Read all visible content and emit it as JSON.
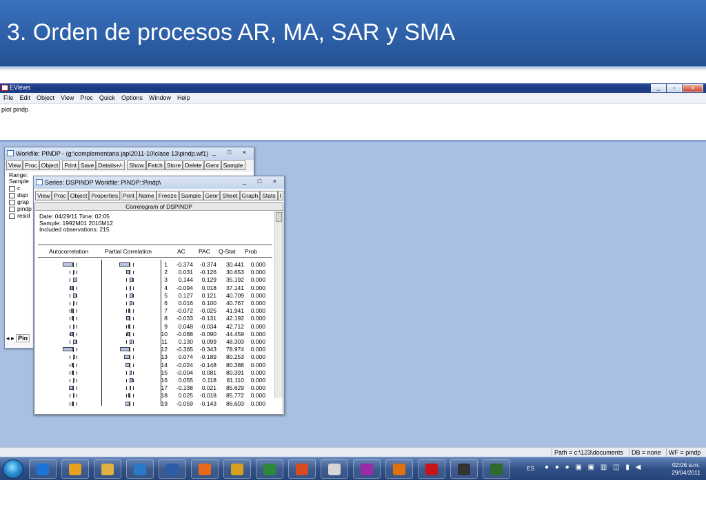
{
  "slide": {
    "title": "3. Orden de procesos AR, MA, SAR y SMA"
  },
  "eviews": {
    "title": "EViews",
    "menu": [
      "File",
      "Edit",
      "Object",
      "View",
      "Proc",
      "Quick",
      "Options",
      "Window",
      "Help"
    ],
    "command": "plot pindp",
    "window_buttons": [
      "_",
      "▫",
      "x"
    ]
  },
  "workfile": {
    "title": "Workfile: PINDP - (g:\\complementaria jap\\2011-10\\clase 13\\pindp.wf1)",
    "toolbar": [
      "View",
      "Proc",
      "Object",
      "Print",
      "Save",
      "Details+/-",
      "Show",
      "Fetch",
      "Store",
      "Delete",
      "Genr",
      "Sample"
    ],
    "range_label": "Range:",
    "sample_label": "Sample",
    "items": [
      "c",
      "dspi",
      "grap",
      "pindp",
      "resid"
    ],
    "tab": "Pin"
  },
  "series": {
    "title": "Series: DSPINDP   Workfile: PINDP::Pindp\\",
    "toolbar": [
      "View",
      "Proc",
      "Object",
      "Properties",
      "Print",
      "Name",
      "Freeze",
      "Sample",
      "Genr",
      "Sheet",
      "Graph",
      "Stats",
      "I"
    ],
    "heading": "Correlogram of DSPINDP",
    "meta": [
      "Date: 04/29/11   Time: 02:05",
      "Sample: 1992M01 2010M12",
      "Included observations: 215"
    ],
    "columns": [
      "Autocorrelation",
      "Partial Correlation",
      "AC",
      "PAC",
      "Q-Stat",
      "Prob"
    ],
    "rows": [
      {
        "lag": "1",
        "ac": "-0.374",
        "pac": "-0.374",
        "q": "30.441",
        "prob": "0.000"
      },
      {
        "lag": "2",
        "ac": "0.031",
        "pac": "-0.126",
        "q": "30.653",
        "prob": "0.000"
      },
      {
        "lag": "3",
        "ac": "0.144",
        "pac": "0.129",
        "q": "35.192",
        "prob": "0.000"
      },
      {
        "lag": "4",
        "ac": "-0.094",
        "pac": "0.018",
        "q": "37.141",
        "prob": "0.000"
      },
      {
        "lag": "5",
        "ac": "0.127",
        "pac": "0.121",
        "q": "40.709",
        "prob": "0.000"
      },
      {
        "lag": "6",
        "ac": "0.016",
        "pac": "0.100",
        "q": "40.767",
        "prob": "0.000"
      },
      {
        "lag": "7",
        "ac": "-0.072",
        "pac": "-0.025",
        "q": "41.941",
        "prob": "0.000"
      },
      {
        "lag": "8",
        "ac": "-0.033",
        "pac": "-0.131",
        "q": "42.192",
        "prob": "0.000"
      },
      {
        "lag": "9",
        "ac": "0.048",
        "pac": "-0.034",
        "q": "42.712",
        "prob": "0.000"
      },
      {
        "lag": "10",
        "ac": "-0.088",
        "pac": "-0.090",
        "q": "44.459",
        "prob": "0.000"
      },
      {
        "lag": "11",
        "ac": "0.130",
        "pac": "0.099",
        "q": "48.303",
        "prob": "0.000"
      },
      {
        "lag": "12",
        "ac": "-0.365",
        "pac": "-0.343",
        "q": "78.974",
        "prob": "0.000"
      },
      {
        "lag": "13",
        "ac": "0.074",
        "pac": "-0.189",
        "q": "80.253",
        "prob": "0.000"
      },
      {
        "lag": "14",
        "ac": "-0.024",
        "pac": "-0.148",
        "q": "80.388",
        "prob": "0.000"
      },
      {
        "lag": "15",
        "ac": "-0.004",
        "pac": "0.081",
        "q": "80.391",
        "prob": "0.000"
      },
      {
        "lag": "16",
        "ac": "0.055",
        "pac": "0.118",
        "q": "81.110",
        "prob": "0.000"
      },
      {
        "lag": "17",
        "ac": "-0.138",
        "pac": "0.021",
        "q": "85.629",
        "prob": "0.000"
      },
      {
        "lag": "18",
        "ac": "0.025",
        "pac": "-0.018",
        "q": "85.772",
        "prob": "0.000"
      },
      {
        "lag": "19",
        "ac": "-0.059",
        "pac": "-0.143",
        "q": "86.603",
        "prob": "0.000"
      }
    ]
  },
  "status": {
    "path": "Path = c:\\123\\documents",
    "db": "DB = none",
    "wf": "WF = pindp"
  },
  "taskbar": {
    "language": "ES",
    "time": "02:06 a.m.",
    "date": "29/04/2011",
    "apps": [
      "ie-icon",
      "outlook-icon",
      "explorer-icon",
      "media-icon",
      "word-icon",
      "firefox-icon",
      "chrome-icon",
      "excel-icon",
      "powerpoint-icon",
      "calc-icon",
      "app-icon",
      "matlab-icon",
      "acrobat-icon",
      "eye-icon",
      "eviews-icon"
    ]
  }
}
